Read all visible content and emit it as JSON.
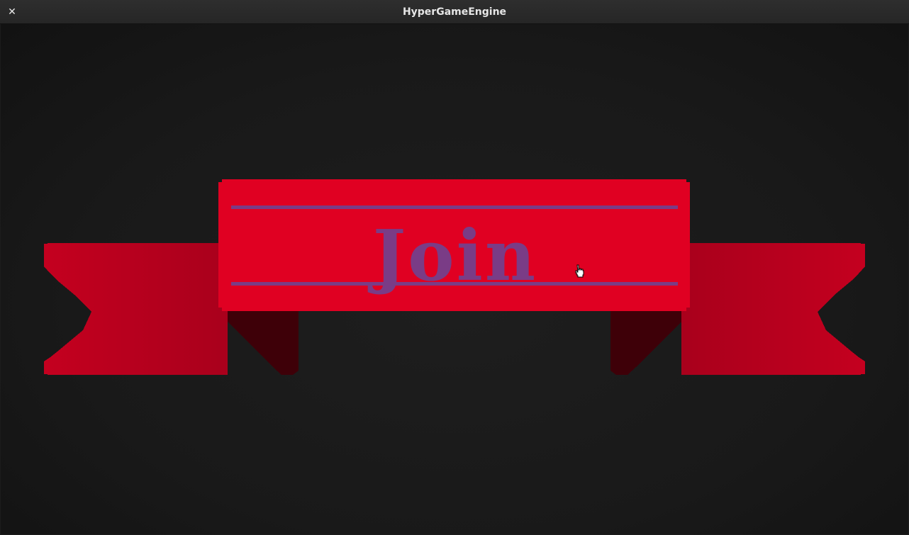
{
  "window": {
    "title": "HyperGameEngine",
    "close_glyph": "✕"
  },
  "menu": {
    "join_label": "Join"
  },
  "colors": {
    "banner": "#e00022",
    "ribbon_tail": "#b10020",
    "fold_shadow": "#3e0008",
    "accent_text": "#7a3c86"
  },
  "icons": {
    "cursor": "hand-pointer-icon",
    "close": "close-icon"
  }
}
